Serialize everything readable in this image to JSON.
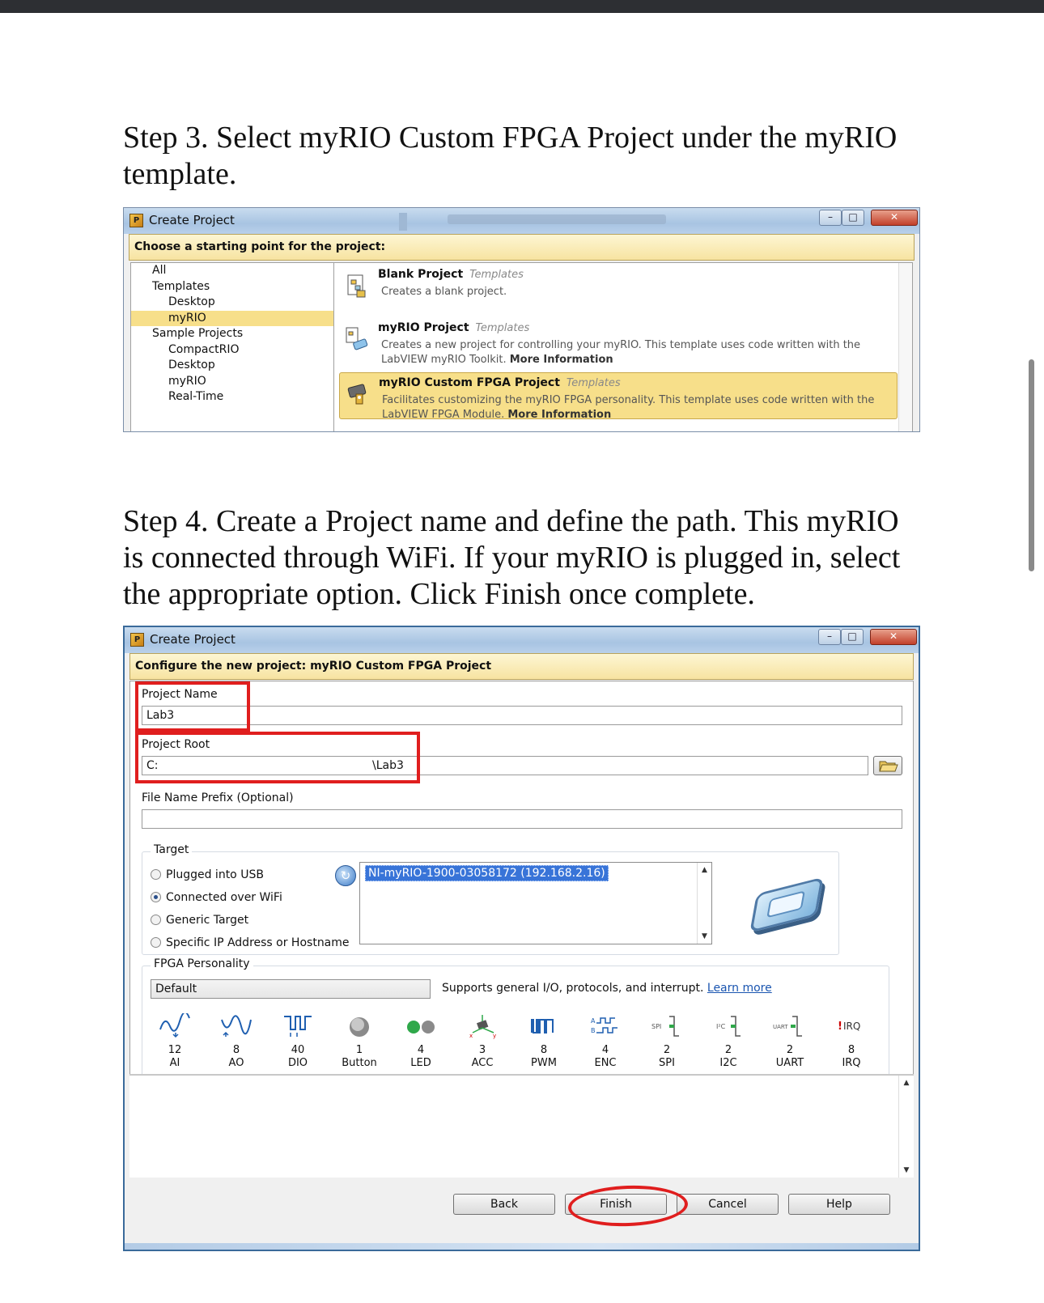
{
  "doc": {
    "step3": "Step 3.  Select myRIO Custom FPGA Project under the myRIO template.",
    "step4": "Step 4.  Create a Project name and define the path.  This myRIO is connected through WiFi.  If your myRIO is plugged in, select the appropriate option.  Click Finish once complete."
  },
  "window1": {
    "title": "Create Project",
    "banner": "Choose a starting point for the project:",
    "tree": [
      {
        "label": "All",
        "indent": false,
        "selected": false
      },
      {
        "label": "Templates",
        "indent": false,
        "selected": false
      },
      {
        "label": "Desktop",
        "indent": true,
        "selected": false
      },
      {
        "label": "myRIO",
        "indent": true,
        "selected": true
      },
      {
        "label": "Sample Projects",
        "indent": false,
        "selected": false
      },
      {
        "label": "CompactRIO",
        "indent": true,
        "selected": false
      },
      {
        "label": "Desktop",
        "indent": true,
        "selected": false
      },
      {
        "label": "myRIO",
        "indent": true,
        "selected": false
      },
      {
        "label": "Real-Time",
        "indent": true,
        "selected": false
      }
    ],
    "templates": [
      {
        "name": "Blank Project",
        "category": "Templates",
        "desc": "Creates a blank project.",
        "more": "",
        "selected": false
      },
      {
        "name": "myRIO Project",
        "category": "Templates",
        "desc": "Creates a new project for controlling your myRIO. This template uses code written with the LabVIEW myRIO Toolkit.",
        "more": "More Information",
        "selected": false
      },
      {
        "name": "myRIO Custom FPGA Project",
        "category": "Templates",
        "desc": "Facilitates customizing the myRIO FPGA personality. This template uses code written with the LabVIEW FPGA Module.",
        "more": "More Information",
        "selected": true
      }
    ]
  },
  "window2": {
    "title": "Create Project",
    "banner": "Configure the new project: myRIO Custom FPGA Project",
    "project_name_label": "Project Name",
    "project_name_value": "Lab3",
    "project_root_label": "Project Root",
    "project_root_drive": "C:",
    "project_root_tail": "\\Lab3",
    "prefix_label": "File Name Prefix (Optional)",
    "prefix_value": "",
    "target_legend": "Target",
    "target_options": [
      {
        "label": "Plugged into USB",
        "selected": false
      },
      {
        "label": "Connected over WiFi",
        "selected": true
      },
      {
        "label": "Generic Target",
        "selected": false
      },
      {
        "label": "Specific IP Address or Hostname",
        "selected": false
      }
    ],
    "target_selected": "NI-myRIO-1900-03058172 (192.168.2.16)",
    "fpga_legend": "FPGA Personality",
    "fpga_value": "Default",
    "fpga_desc": "Supports general I/O, protocols, and interrupt.",
    "learn_more": "Learn more",
    "resources": [
      {
        "count": "12",
        "label": "AI",
        "icon": "analog-input-icon"
      },
      {
        "count": "8",
        "label": "AO",
        "icon": "analog-output-icon"
      },
      {
        "count": "40",
        "label": "DIO",
        "icon": "digital-io-icon"
      },
      {
        "count": "1",
        "label": "Button",
        "icon": "button-icon"
      },
      {
        "count": "4",
        "label": "LED",
        "icon": "led-icon"
      },
      {
        "count": "3",
        "label": "ACC",
        "icon": "accelerometer-icon"
      },
      {
        "count": "8",
        "label": "PWM",
        "icon": "pwm-icon"
      },
      {
        "count": "4",
        "label": "ENC",
        "icon": "encoder-icon"
      },
      {
        "count": "2",
        "label": "SPI",
        "icon": "spi-icon"
      },
      {
        "count": "2",
        "label": "I2C",
        "icon": "i2c-icon"
      },
      {
        "count": "2",
        "label": "UART",
        "icon": "uart-icon"
      },
      {
        "count": "8",
        "label": "IRQ",
        "icon": "irq-icon"
      }
    ],
    "buttons": {
      "back": "Back",
      "finish": "Finish",
      "cancel": "Cancel",
      "help": "Help"
    }
  },
  "colors": {
    "highlight": "#f7df8a",
    "annotation": "#e01e1e",
    "selection": "#3874d8"
  }
}
